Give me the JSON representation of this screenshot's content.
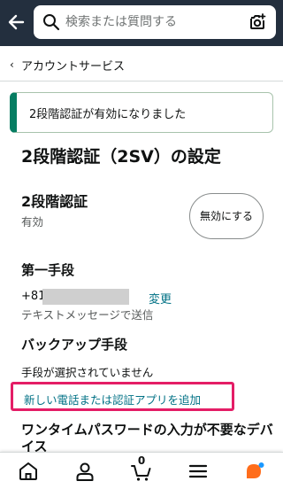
{
  "header": {
    "search_placeholder": "検索または質問する"
  },
  "breadcrumb": {
    "chevron": "‹",
    "label": "アカウントサービス"
  },
  "alert": {
    "text": "2段階認証が有効になりました",
    "color": "#067d62"
  },
  "page": {
    "title": "2段階認証（2SV）の設定"
  },
  "two_step": {
    "title": "2段階認証",
    "status": "有効",
    "disable_button": "無効にする"
  },
  "primary_method": {
    "title": "第一手段",
    "phone_prefix": "+81",
    "change_link": "変更",
    "delivery": "テキストメッセージで送信"
  },
  "backup_method": {
    "title": "バックアップ手段",
    "none_selected": "手段が選択されていません",
    "add_link": "新しい電話または認証アプリを追加"
  },
  "otp_section": {
    "title": "ワンタイムパスワードの入力が不要なデバイス"
  },
  "bottom_nav": {
    "cart_count": "0",
    "items": [
      "home-icon",
      "account-icon",
      "cart-icon",
      "menu-icon",
      "rufus-icon"
    ]
  },
  "colors": {
    "header_bg": "#232f3e",
    "link": "#007185",
    "highlight": "#e41d66",
    "assistant_orange": "#ff6d1b",
    "assistant_blue": "#1a98ff"
  }
}
